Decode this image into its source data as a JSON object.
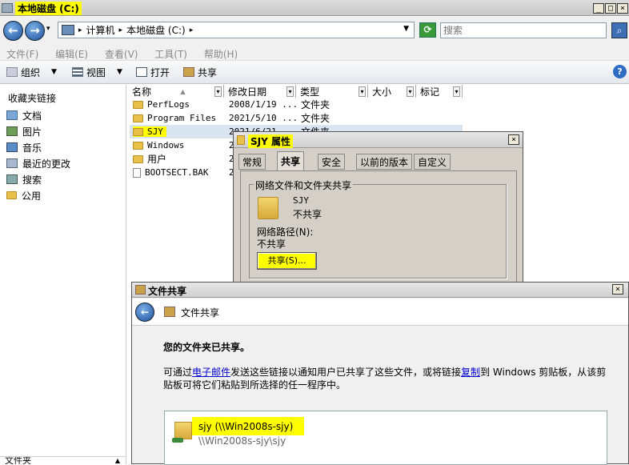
{
  "window": {
    "title": "本地磁盘 (C:)"
  },
  "address": {
    "computer": "计算机",
    "disk": "本地磁盘 (C:)",
    "search_placeholder": "搜索"
  },
  "menu": [
    "文件(F)",
    "编辑(E)",
    "查看(V)",
    "工具(T)",
    "帮助(H)"
  ],
  "toolbar": {
    "organize": "组织",
    "views": "视图",
    "open": "打开",
    "share": "共享"
  },
  "nav": {
    "heading": "收藏夹链接",
    "items": [
      "文档",
      "图片",
      "音乐",
      "最近的更改",
      "搜索",
      "公用"
    ],
    "bottom": "文件夹"
  },
  "columns": [
    "名称",
    "修改日期",
    "类型",
    "大小",
    "标记"
  ],
  "files": [
    {
      "name": "PerfLogs",
      "date": "2008/1/19 ...",
      "type": "文件夹"
    },
    {
      "name": "Program Files",
      "date": "2021/5/10 ...",
      "type": "文件夹"
    },
    {
      "name": "SJY",
      "date": "2021/6/21 ...",
      "type": "文件夹"
    },
    {
      "name": "Windows",
      "date": "2",
      "type": ""
    },
    {
      "name": "用户",
      "date": "2",
      "type": ""
    },
    {
      "name": "BOOTSECT.BAK",
      "date": "2",
      "type": ""
    }
  ],
  "props": {
    "title": "SJY 属性",
    "tabs": [
      "常规",
      "共享",
      "安全",
      "以前的版本",
      "自定义"
    ],
    "group": "网络文件和文件夹共享",
    "folder_name": "SJY",
    "folder_state": "不共享",
    "net_path_label": "网络路径(N):",
    "net_path": "不共享",
    "share_button": "共享(S)..."
  },
  "share": {
    "title": "文件共享",
    "header": "文件共享",
    "done": "您的文件夹已共享。",
    "desc_pre": "可通过",
    "desc_link1": "电子邮件",
    "desc_mid": "发送这些链接以通知用户已共享了这些文件，或将链接",
    "desc_link2": "复制",
    "desc_post": "到 Windows 剪贴板，从该剪贴板可将它们粘贴到所选择的任一程序中。",
    "item_name": "sjy (\\\\Win2008s-sjy)",
    "item_path": "\\\\Win2008s-sjy\\sjy"
  }
}
